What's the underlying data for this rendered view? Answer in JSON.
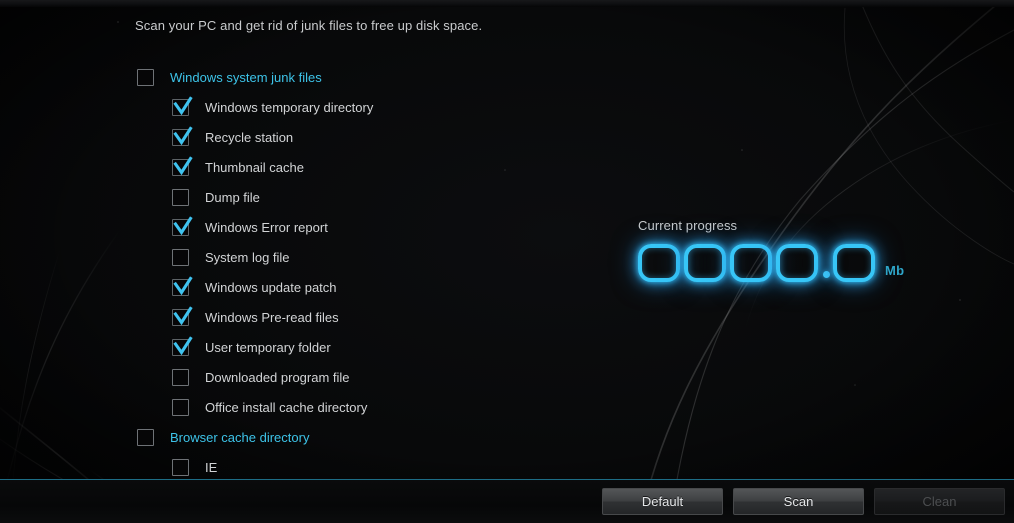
{
  "window": {
    "intro_text": "Scan your PC and get rid of junk files to free up disk space."
  },
  "colors": {
    "accent_cyan": "#3dc3e8",
    "glow_blue": "#37c6f7",
    "separator": "#1d6d86",
    "label_gray": "#d2d4d6",
    "background": "#050607"
  },
  "tree": {
    "items": [
      {
        "label": "Windows system junk files",
        "level": 0,
        "checked": false
      },
      {
        "label": "Windows temporary directory",
        "level": 1,
        "checked": true
      },
      {
        "label": "Recycle station",
        "level": 1,
        "checked": true
      },
      {
        "label": "Thumbnail cache",
        "level": 1,
        "checked": true
      },
      {
        "label": "Dump file",
        "level": 1,
        "checked": false
      },
      {
        "label": "Windows Error report",
        "level": 1,
        "checked": true
      },
      {
        "label": "System log file",
        "level": 1,
        "checked": false
      },
      {
        "label": "Windows update patch",
        "level": 1,
        "checked": true
      },
      {
        "label": "Windows Pre-read files",
        "level": 1,
        "checked": true
      },
      {
        "label": "User temporary folder",
        "level": 1,
        "checked": true
      },
      {
        "label": "Downloaded program file",
        "level": 1,
        "checked": false
      },
      {
        "label": "Office install cache directory",
        "level": 1,
        "checked": false
      },
      {
        "label": "Browser cache directory",
        "level": 0,
        "checked": false
      },
      {
        "label": "IE",
        "level": 1,
        "checked": false
      }
    ]
  },
  "progress": {
    "title": "Current progress",
    "digits": [
      "0",
      "0",
      "0",
      "0"
    ],
    "decimal_digits": [
      "0"
    ],
    "decimal_separator": ".",
    "unit": "Mb",
    "value": "0000.0"
  },
  "footer": {
    "buttons": [
      {
        "label": "Default",
        "disabled": false,
        "name": "default-button"
      },
      {
        "label": "Scan",
        "disabled": false,
        "name": "scan-button"
      },
      {
        "label": "Clean",
        "disabled": true,
        "name": "clean-button"
      }
    ]
  }
}
